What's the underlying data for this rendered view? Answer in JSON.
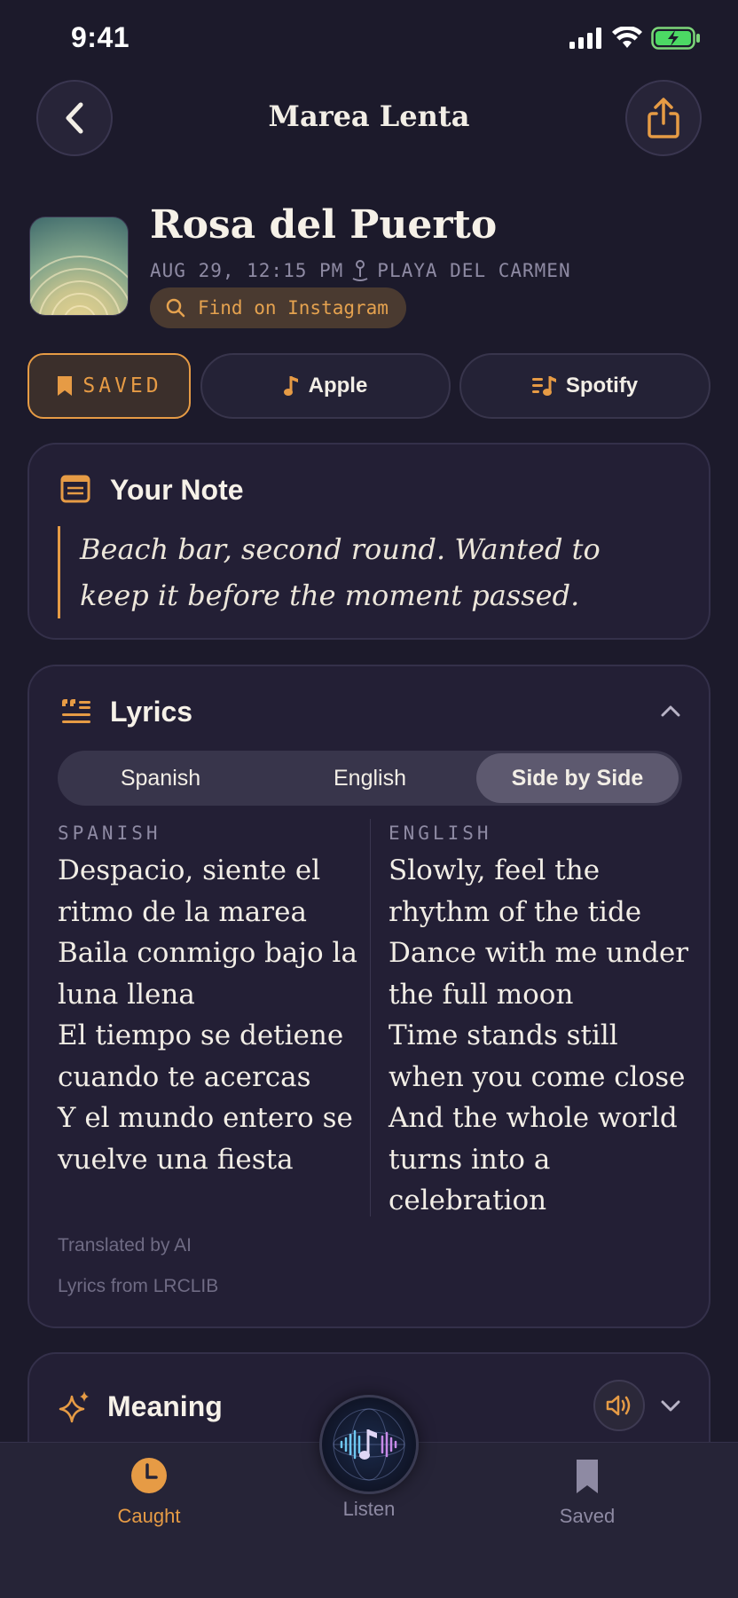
{
  "status": {
    "time": "9:41"
  },
  "header": {
    "title": "Marea Lenta"
  },
  "song": {
    "title": "Rosa del Puerto",
    "date": "AUG 29, 12:15 PM",
    "location": "PLAYA DEL CARMEN",
    "instagram_label": "Find on Instagram"
  },
  "actions": {
    "saved": "SAVED",
    "apple": "Apple",
    "spotify": "Spotify"
  },
  "note": {
    "title": "Your Note",
    "text": "Beach bar, second round. Wanted to keep it before the moment passed."
  },
  "lyrics": {
    "title": "Lyrics",
    "tabs": [
      "Spanish",
      "English",
      "Side by Side"
    ],
    "active_tab": "Side by Side",
    "spanish_label": "SPANISH",
    "english_label": "ENGLISH",
    "spanish_lines": [
      "Despacio, siente el",
      "ritmo de la marea",
      "Baila conmigo bajo la",
      "luna llena",
      "El tiempo se detiene",
      "cuando te acercas",
      "Y el mundo entero se",
      "vuelve una fiesta"
    ],
    "english_lines": [
      "Slowly, feel the",
      "rhythm of the tide",
      "Dance with me under",
      "the full moon",
      "Time stands still",
      "when you come close",
      "And the whole world",
      "turns into a",
      "celebration"
    ],
    "translated_note": "Translated by AI",
    "source_note": "Lyrics from LRCLIB"
  },
  "meaning": {
    "title": "Meaning"
  },
  "tabbar": {
    "caught": "Caught",
    "listen": "Listen",
    "saved": "Saved"
  },
  "colors": {
    "accent": "#e69b45",
    "background": "#1c1a2b",
    "card": "#231f35"
  }
}
